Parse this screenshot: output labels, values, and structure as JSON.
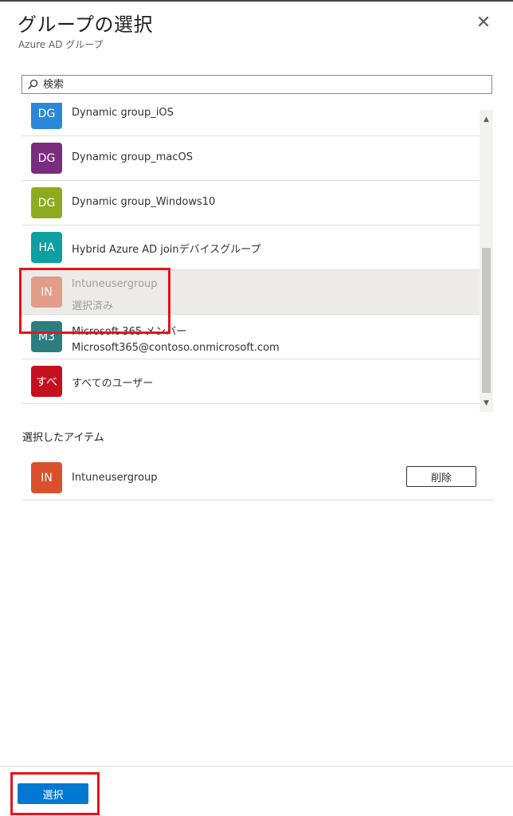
{
  "header": {
    "title": "グループの選択",
    "subtitle": "Azure AD グループ",
    "close_glyph": "✕"
  },
  "search": {
    "placeholder": "検索",
    "value": ""
  },
  "groups": [
    {
      "initials": "DG",
      "color": "#2b88d8",
      "line1": "Dynamic group_iOS",
      "line2": ""
    },
    {
      "initials": "DG",
      "color": "#7a2c7e",
      "line1": "Dynamic group_macOS",
      "line2": ""
    },
    {
      "initials": "DG",
      "color": "#8cab1f",
      "line1": "Dynamic group_Windows10",
      "line2": ""
    },
    {
      "initials": "HA",
      "color": "#0e9fa0",
      "line1": "Hybrid Azure AD joinデバイスグループ",
      "line2": ""
    },
    {
      "initials": "IN",
      "color": "#d9512c",
      "line1": "Intuneusergroup",
      "line2": "選択済み",
      "selected": true
    },
    {
      "initials": "M3",
      "color": "#2a7f7e",
      "line1": "Microsoft 365 メンバー",
      "line2": "Microsoft365@contoso.onmicrosoft.com"
    },
    {
      "initials": "すべ",
      "color": "#c50f1f",
      "line1": "すべてのユーザー",
      "line2": ""
    }
  ],
  "scrollbar": {
    "up": "▲",
    "down": "▼"
  },
  "selected_items": {
    "title": "選択したアイテム",
    "items": [
      {
        "initials": "IN",
        "color": "#d9512c",
        "name": "Intuneusergroup",
        "remove_label": "削除"
      }
    ]
  },
  "footer": {
    "select_label": "選択"
  },
  "colors": {
    "primary": "#0078d4",
    "highlight": "#e8121a"
  }
}
